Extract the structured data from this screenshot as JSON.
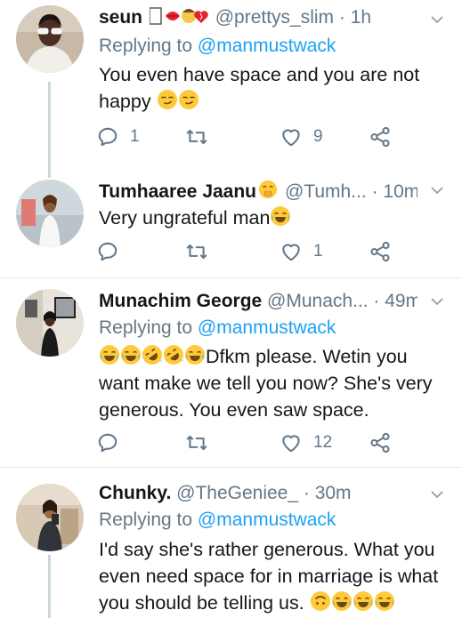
{
  "tweets": [
    {
      "name": "seun ",
      "handle": "@prettys_slim · 1h",
      "replying_label": "Replying to",
      "replying_to": "@manmustwack",
      "text_1": "You even have space and you are not",
      "text_2": "happy ",
      "reply_count": "1",
      "retweet_count": "",
      "like_count": "9"
    },
    {
      "name": "Tumhaaree Jaanu",
      "handle": "@Tumh... · 10m",
      "text_1": "Very ungrateful man",
      "reply_count": "",
      "retweet_count": "",
      "like_count": "1"
    },
    {
      "name": "Munachim George",
      "handle": "@Munach... · 49m",
      "replying_label": "Replying to",
      "replying_to": "@manmustwack",
      "text_1": "Dfkm please. Wetin you",
      "text_2": "want make we tell you now? She's very",
      "text_3": "generous. You even saw space.",
      "reply_count": "",
      "retweet_count": "",
      "like_count": "12"
    },
    {
      "name": "Chunky.",
      "handle": "@TheGeniee_ · 30m",
      "replying_label": "Replying to",
      "replying_to": "@manmustwack",
      "text_1": "I'd say she's rather generous. What you",
      "text_2": "even need space for in marriage is what",
      "text_3": "you should be telling us. "
    }
  ],
  "colors": {
    "accent": "#1da1f2",
    "secondary_text": "#657786",
    "divider": "#e1e8ed",
    "thread_line": "#ccd6dd"
  },
  "icons": [
    "reply-icon",
    "retweet-icon",
    "like-icon",
    "share-icon",
    "chevron-down-icon"
  ]
}
